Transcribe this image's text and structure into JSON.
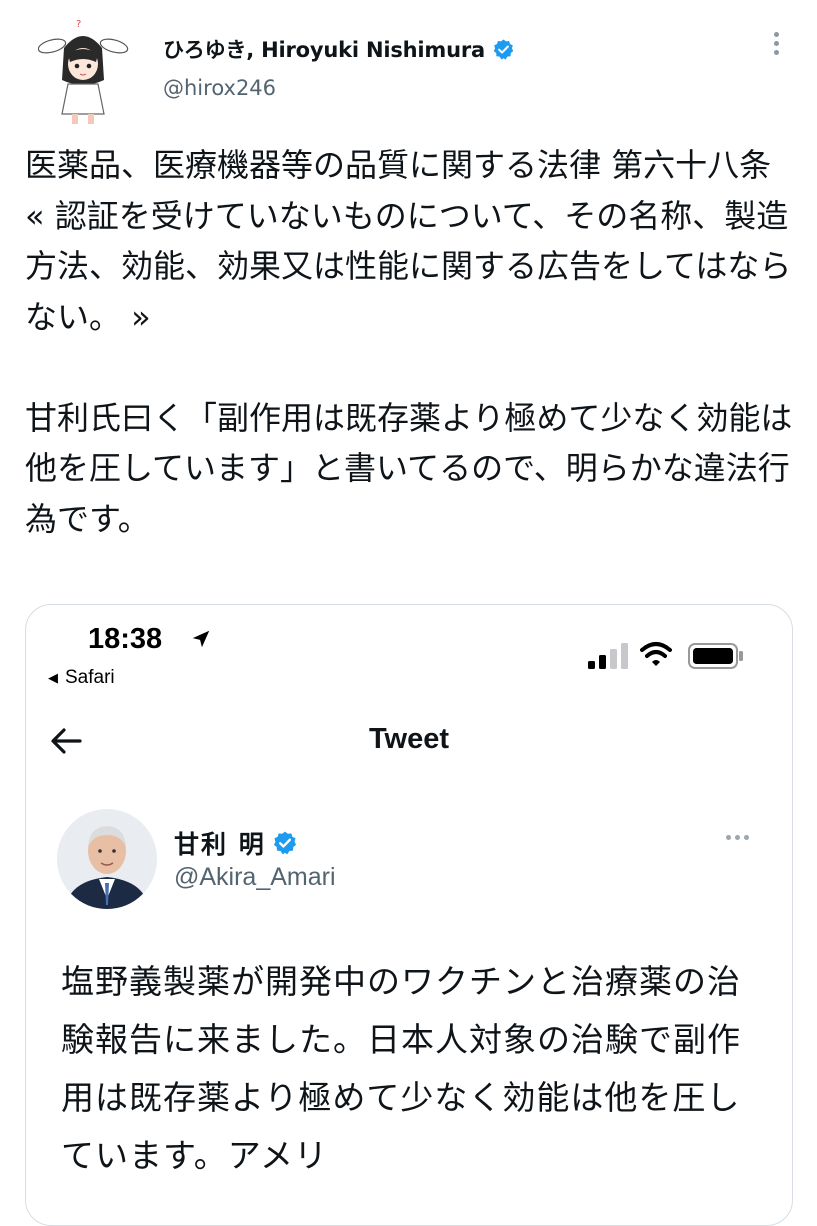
{
  "tweet": {
    "author_name": "ひろゆき, Hiroyuki Nishimura",
    "author_handle": "@hirox246",
    "author_avatar": "anime-character-avatar",
    "verified_icon": "verified-badge-icon",
    "more_icon": "more-vertical-icon",
    "text": "医薬品、医療機器等の品質に関する法律 第六十八条\n« 認証を受けていないものについて、その名称、製造方法、効能、効果又は性能に関する広告をしてはならない。 »\n\n甘利氏曰く「副作用は既存薬より極めて少なく効能は他を圧しています」と書いてるので、明らかな違法行為です。"
  },
  "screenshot": {
    "status_bar": {
      "time": "18:38",
      "back_app": "Safari",
      "signal_bars": 4,
      "signal_active": 2,
      "battery_level": 0.85
    },
    "nav": {
      "title": "Tweet",
      "back_icon": "arrow-left-icon"
    },
    "embedded_tweet": {
      "author_name": "甘利 明",
      "author_handle": "@Akira_Amari",
      "more_icon": "more-horizontal-icon",
      "text": "塩野義製薬が開発中のワクチンと治療薬の治験報告に来ました。日本人対象の治験で副作用は既存薬より極めて少なく効能は他を圧しています。アメリ"
    }
  },
  "colors": {
    "text": "#0f1419",
    "secondary": "#536471",
    "verified": "#1d9bf0",
    "border": "#d7dde2"
  }
}
